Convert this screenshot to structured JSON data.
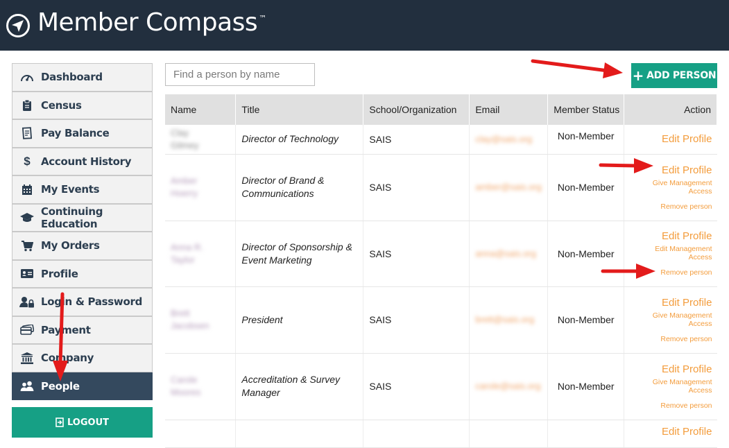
{
  "app": {
    "title": "Member Compass",
    "tm": "™"
  },
  "sidebar": {
    "items": [
      {
        "label": "Dashboard",
        "icon": "dashboard-icon"
      },
      {
        "label": "Census",
        "icon": "clipboard-icon"
      },
      {
        "label": "Pay Balance",
        "icon": "receipt-icon"
      },
      {
        "label": "Account History",
        "icon": "dollar-icon"
      },
      {
        "label": "My Events",
        "icon": "calendar-icon"
      },
      {
        "label": "Continuing Education",
        "icon": "graduation-cap-icon"
      },
      {
        "label": "My Orders",
        "icon": "cart-icon"
      },
      {
        "label": "Profile",
        "icon": "id-card-icon"
      },
      {
        "label": "Login & Password",
        "icon": "user-lock-icon"
      },
      {
        "label": "Payment",
        "icon": "credit-card-icon"
      },
      {
        "label": "Company",
        "icon": "bank-icon"
      },
      {
        "label": "People",
        "icon": "users-icon",
        "active": true
      }
    ],
    "logout_label": "LOGOUT"
  },
  "search": {
    "placeholder": "Find a person by name"
  },
  "add_person_label": "ADD PERSON",
  "table": {
    "headers": [
      "Name",
      "Title",
      "School/Organization",
      "Email",
      "Member Status",
      "Action"
    ],
    "rows": [
      {
        "name": "Clay Gilmey",
        "title": "Director of Technology",
        "org": "SAIS",
        "email": "clay@sais.org",
        "status": "Non-Member",
        "edit": "Edit Profile",
        "manage": "",
        "remove": ""
      },
      {
        "name": "Amber Hoerry",
        "title": "Director of Brand & Communications",
        "org": "SAIS",
        "email": "amber@sais.org",
        "status": "Non-Member",
        "edit": "Edit Profile",
        "manage": "Give Management Access",
        "remove": "Remove person"
      },
      {
        "name": "Anna R. Taylor",
        "title": "Director of Sponsorship & Event Marketing",
        "org": "SAIS",
        "email": "anna@sais.org",
        "status": "Non-Member",
        "edit": "Edit Profile",
        "manage": "Edit Management Access",
        "remove": "Remove person"
      },
      {
        "name": "Brett Jacobsen",
        "title": "President",
        "org": "SAIS",
        "email": "brett@sais.org",
        "status": "Non-Member",
        "edit": "Edit Profile",
        "manage": "Give Management Access",
        "remove": "Remove person"
      },
      {
        "name": "Carole Moores",
        "title": "Accreditation & Survey Manager",
        "org": "SAIS",
        "email": "carole@sais.org",
        "status": "Non-Member",
        "edit": "Edit Profile",
        "manage": "Give Management Access",
        "remove": "Remove person"
      },
      {
        "name": "",
        "title": "",
        "org": "",
        "email": "",
        "status": "",
        "edit": "Edit Profile",
        "manage": "",
        "remove": ""
      }
    ]
  },
  "colors": {
    "topbar": "#222f3e",
    "accent": "#16a085",
    "action": "#f39c3c",
    "active_nav": "#34495e",
    "annotation_arrow": "#e31b1b"
  }
}
